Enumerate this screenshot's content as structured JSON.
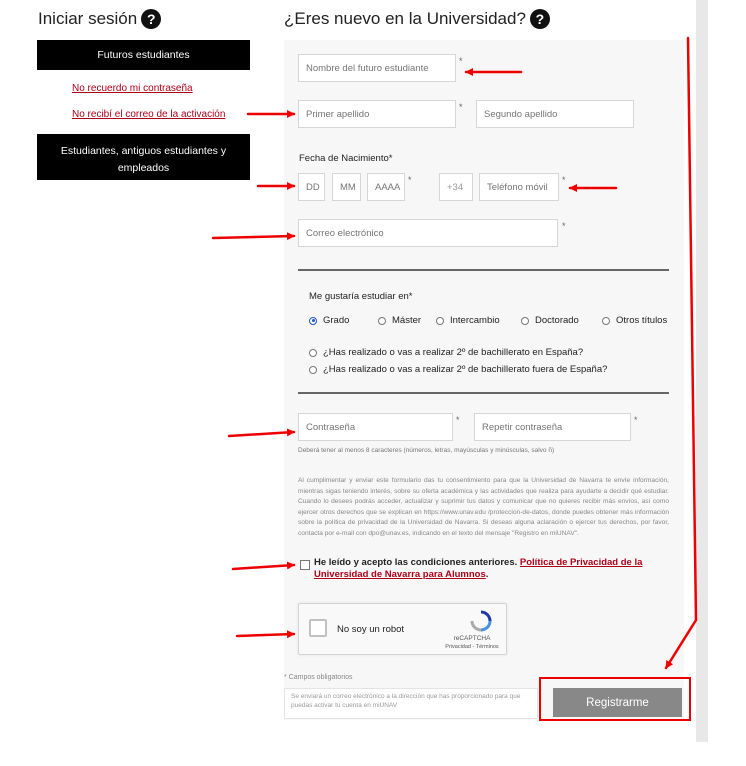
{
  "login": {
    "title": "Iniciar sesión",
    "help_icon": "question-circle-icon",
    "future_students_label": "Futuros estudiantes",
    "links": [
      "No recuerdo mi contraseña",
      "No recibí el correo de la activación"
    ],
    "others_label": "Estudiantes, antiguos estudiantes y empleados"
  },
  "register": {
    "title": "¿Eres nuevo en la Universidad?",
    "help_icon": "question-circle-icon",
    "name_placeholder": "Nombre del futuro estudiante",
    "surname1_placeholder": "Primer apellido",
    "surname2_placeholder": "Segundo apellido",
    "birth_label": "Fecha de Nacimiento*",
    "day_placeholder": "DD",
    "month_placeholder": "MM",
    "year_placeholder": "AAAA",
    "phone_prefix": "+34",
    "phone_placeholder": "Teléfono móvil",
    "email_placeholder": "Correo electrónico",
    "study_label": "Me gustaría estudiar en*",
    "study_options": [
      "Grado",
      "Máster",
      "Intercambio",
      "Doctorado",
      "Otros títulos"
    ],
    "selected_study": "Grado",
    "bachillerato_options": [
      "¿Has realizado o vas a realizar 2º de bachillerato en España?",
      "¿Has realizado o vas a realizar 2º de bachillerato fuera de España?"
    ],
    "password_placeholder": "Contraseña",
    "repeat_password_placeholder": "Repetir contraseña",
    "password_hint": "Deberá tener al menos 8 caracteres (números, letras, mayúsculas y minúsculas, salvo ñ)",
    "legal_text": "Al cumplimentar y enviar este formulario das tu consentimiento para que la Universidad de Navarra te envíe información, mientras sigas teniendo interés, sobre su oferta académica y las actividades que realiza para ayudarte a decidir qué estudiar. Cuando lo desees podrás acceder, actualizar y suprimir tus datos y comunicar que no quieres recibir más envíos, así como ejercer otros derechos que se explican en https://www.unav.edu /proteccion-de-datos, donde puedes obtener más información sobre la política de privacidad de la Universidad de Navarra. Si deseas alguna aclaración o ejercer tus derechos, por favor, contacta por e-mail con dpo@unav.es, indicando en el texto del mensaje \"Registro en miUNAV\".",
    "consent_text": "He leído y acepto las condiciones anteriores.",
    "consent_link": "Política de Privacidad de la Universidad de Navarra para Alumnos",
    "consent_end": ".",
    "recaptcha_label": "No soy un robot",
    "recaptcha_brand": "reCAPTCHA",
    "recaptcha_terms": "Privacidad - Términos",
    "recaptcha_icon": "recaptcha-icon",
    "required_note": "* Campos obligatorios",
    "info_text": "Se enviará un correo electrónico a la dirección que has proporcionado para que puedas activar tu cuenta en miUNAV",
    "register_button": "Registrarme",
    "star": "*"
  },
  "colors": {
    "annotation": "#e00000",
    "link": "#b0001a",
    "button": "#888888",
    "radio_selected": "#1a56c8"
  }
}
